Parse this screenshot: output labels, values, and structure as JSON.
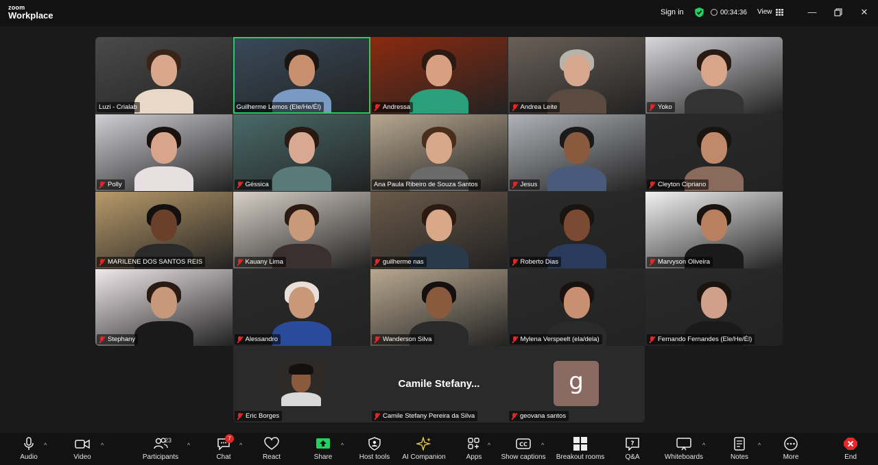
{
  "app": {
    "logo_top": "zoom",
    "logo_bottom": "Workplace",
    "sign_in": "Sign in",
    "timer": "00:34:36",
    "view": "View"
  },
  "gallery": {
    "tiles": [
      {
        "name": "Luzi - Crialab",
        "muted": false,
        "bg": "#4a4a4a",
        "skin": "#d9a88c",
        "hair": "#3a2418",
        "shirt": "#e8d8c8"
      },
      {
        "name": "Guilherme Lemos (Ele/He/Él)",
        "muted": false,
        "bg": "#394a5a",
        "skin": "#c99070",
        "hair": "#1c1410",
        "shirt": "#7a9ac4"
      },
      {
        "name": "Andressa",
        "muted": true,
        "bg": "#8a2a10",
        "skin": "#d8a080",
        "hair": "#2a1a12",
        "shirt": "#2aa07a"
      },
      {
        "name": "Andrea Leite",
        "muted": true,
        "bg": "#6a6058",
        "skin": "#d8a88e",
        "hair": "#b8b2aa",
        "shirt": "#5a4a40"
      },
      {
        "name": "Yoko",
        "muted": true,
        "bg": "#d8d8dc",
        "skin": "#d8a48a",
        "hair": "#2a1a14",
        "shirt": "#333333"
      },
      {
        "name": "Polly",
        "muted": true,
        "bg": "#cfcfd4",
        "skin": "#d8a48c",
        "hair": "#1a1210",
        "shirt": "#e8e0e0"
      },
      {
        "name": "Géssica",
        "muted": true,
        "bg": "#4a6a6a",
        "skin": "#d8a890",
        "hair": "#2a1a14",
        "shirt": "#5a7a7a"
      },
      {
        "name": "Ana Paula Ribeiro de Souza Santos",
        "muted": false,
        "bg": "#b8a890",
        "skin": "#d8a88a",
        "hair": "#4a2e1c",
        "shirt": "#6a6a6a"
      },
      {
        "name": "Jesus",
        "muted": true,
        "bg": "#b0b2b8",
        "skin": "#8a5a3e",
        "hair": "#1a1a1a",
        "shirt": "#4a5a7a"
      },
      {
        "name": "Cleyton Cipriano",
        "muted": true,
        "bg": "#2a2a2a",
        "skin": "#c08a6a",
        "hair": "#1a1410",
        "shirt": "#8a6a5a"
      },
      {
        "name": "MARILENE DOS SANTOS REIS",
        "muted": true,
        "bg": "#b89a6a",
        "skin": "#6a402a",
        "hair": "#141010",
        "shirt": "#2a2a2a"
      },
      {
        "name": "Kauany Lima",
        "muted": true,
        "bg": "#d8d0c8",
        "skin": "#c89a7a",
        "hair": "#2a1a12",
        "shirt": "#3a3030"
      },
      {
        "name": "guilherme nas",
        "muted": true,
        "bg": "#6a5a4a",
        "skin": "#d8a888",
        "hair": "#2a1a12",
        "shirt": "#2a3a4a"
      },
      {
        "name": "Roberto Dias",
        "muted": true,
        "bg": "#2a2a2a",
        "skin": "#7a4a32",
        "hair": "#1a1410",
        "shirt": "#2a3a5a"
      },
      {
        "name": "Marvyson Oliveira",
        "muted": true,
        "bg": "#f2f2f2",
        "skin": "#b8805e",
        "hair": "#1a1410",
        "shirt": "#1a1a1a"
      },
      {
        "name": "Stephany",
        "muted": true,
        "bg": "#f0e8ea",
        "skin": "#c8987a",
        "hair": "#2a1a14",
        "shirt": "#1a1a1a"
      },
      {
        "name": "Alessandro",
        "muted": true,
        "bg": "#2a2a2a",
        "skin": "#c89878",
        "hair": "#e8e0d8",
        "shirt": "#2a4a9a"
      },
      {
        "name": "Wanderson Silva",
        "muted": true,
        "bg": "#b8a890",
        "skin": "#8a5a3e",
        "hair": "#141010",
        "shirt": "#2a2a2a"
      },
      {
        "name": "Mylena Verspeelt (ela/dela)",
        "muted": true,
        "bg": "#2a2a2a",
        "skin": "#c89070",
        "hair": "#1a1210",
        "shirt": "#2a2a2a"
      },
      {
        "name": "Fernando Fernandes (Ele/He/Él)",
        "muted": true,
        "bg": "#2a2a2a",
        "skin": "#d0a08a",
        "hair": "#1a1410",
        "shirt": "#1a1a1a"
      }
    ]
  },
  "bottom_row": {
    "eric": {
      "name": "Eric Borges"
    },
    "camile": {
      "display": "Camile  Stefany...",
      "name": "Camile Stefany Pereira da Silva"
    },
    "geovana": {
      "initial": "g",
      "name": "geovana santos"
    }
  },
  "toolbar": {
    "audio": "Audio",
    "video": "Video",
    "participants": "Participants",
    "participants_count": "23",
    "chat": "Chat",
    "chat_badge": "7",
    "react": "React",
    "share": "Share",
    "host_tools": "Host tools",
    "ai_companion": "AI Companion",
    "apps": "Apps",
    "show_captions": "Show captions",
    "breakout_rooms": "Breakout rooms",
    "qa": "Q&A",
    "whiteboards": "Whiteboards",
    "notes": "Notes",
    "more": "More",
    "end": "End"
  },
  "colors": {
    "active_speaker": "#23d160",
    "muted": "#e02828",
    "share_green": "#23d160",
    "end_red": "#e02828"
  }
}
